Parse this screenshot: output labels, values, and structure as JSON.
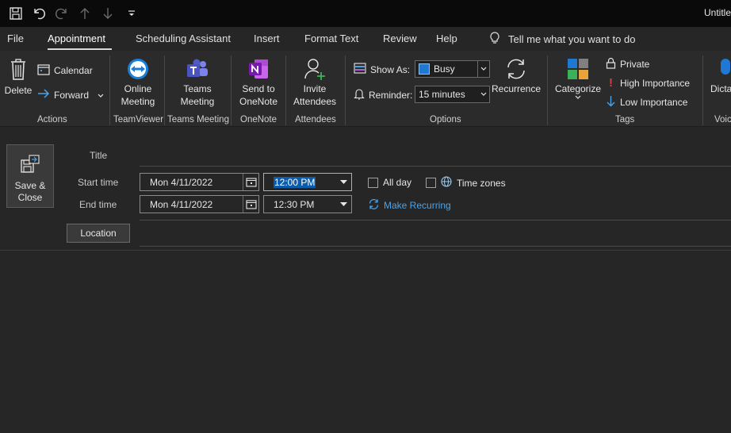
{
  "window": {
    "title": "Untitle"
  },
  "menu": {
    "tabs": [
      {
        "label": "File"
      },
      {
        "label": "Appointment"
      },
      {
        "label": "Scheduling Assistant"
      },
      {
        "label": "Insert"
      },
      {
        "label": "Format Text"
      },
      {
        "label": "Review"
      },
      {
        "label": "Help"
      }
    ],
    "tell_me": "Tell me what you want to do"
  },
  "ribbon": {
    "actions": {
      "delete": "Delete",
      "calendar": "Calendar",
      "forward": "Forward",
      "group": "Actions"
    },
    "teamviewer": {
      "line1": "Online",
      "line2": "Meeting",
      "group": "TeamViewer"
    },
    "teams": {
      "line1": "Teams",
      "line2": "Meeting",
      "group": "Teams Meeting"
    },
    "onenote": {
      "line1": "Send to",
      "line2": "OneNote",
      "group": "OneNote"
    },
    "attendees": {
      "line1": "Invite",
      "line2": "Attendees",
      "group": "Attendees"
    },
    "options": {
      "show_as_label": "Show As:",
      "show_as_value": "Busy",
      "show_as_color": "#1e78d4",
      "reminder_label": "Reminder:",
      "reminder_value": "15 minutes",
      "recurrence": "Recurrence",
      "group": "Options"
    },
    "tags": {
      "categorize": "Categorize",
      "private": "Private",
      "high": "High Importance",
      "low": "Low Importance",
      "group": "Tags"
    },
    "voice": {
      "dictate": "Dicta",
      "group": "Voic"
    }
  },
  "form": {
    "save_close_line1": "Save &",
    "save_close_line2": "Close",
    "title_label": "Title",
    "start_label": "Start time",
    "end_label": "End time",
    "start_date": "Mon 4/11/2022",
    "start_time": "12:00 PM",
    "end_date": "Mon 4/11/2022",
    "end_time": "12:30 PM",
    "all_day": "All day",
    "time_zones": "Time zones",
    "make_recurring": "Make Recurring",
    "location": "Location"
  },
  "colors": {
    "accent": "#4aa3e8",
    "selection": "#0b5cad",
    "high_importance": "#e03c3c"
  }
}
